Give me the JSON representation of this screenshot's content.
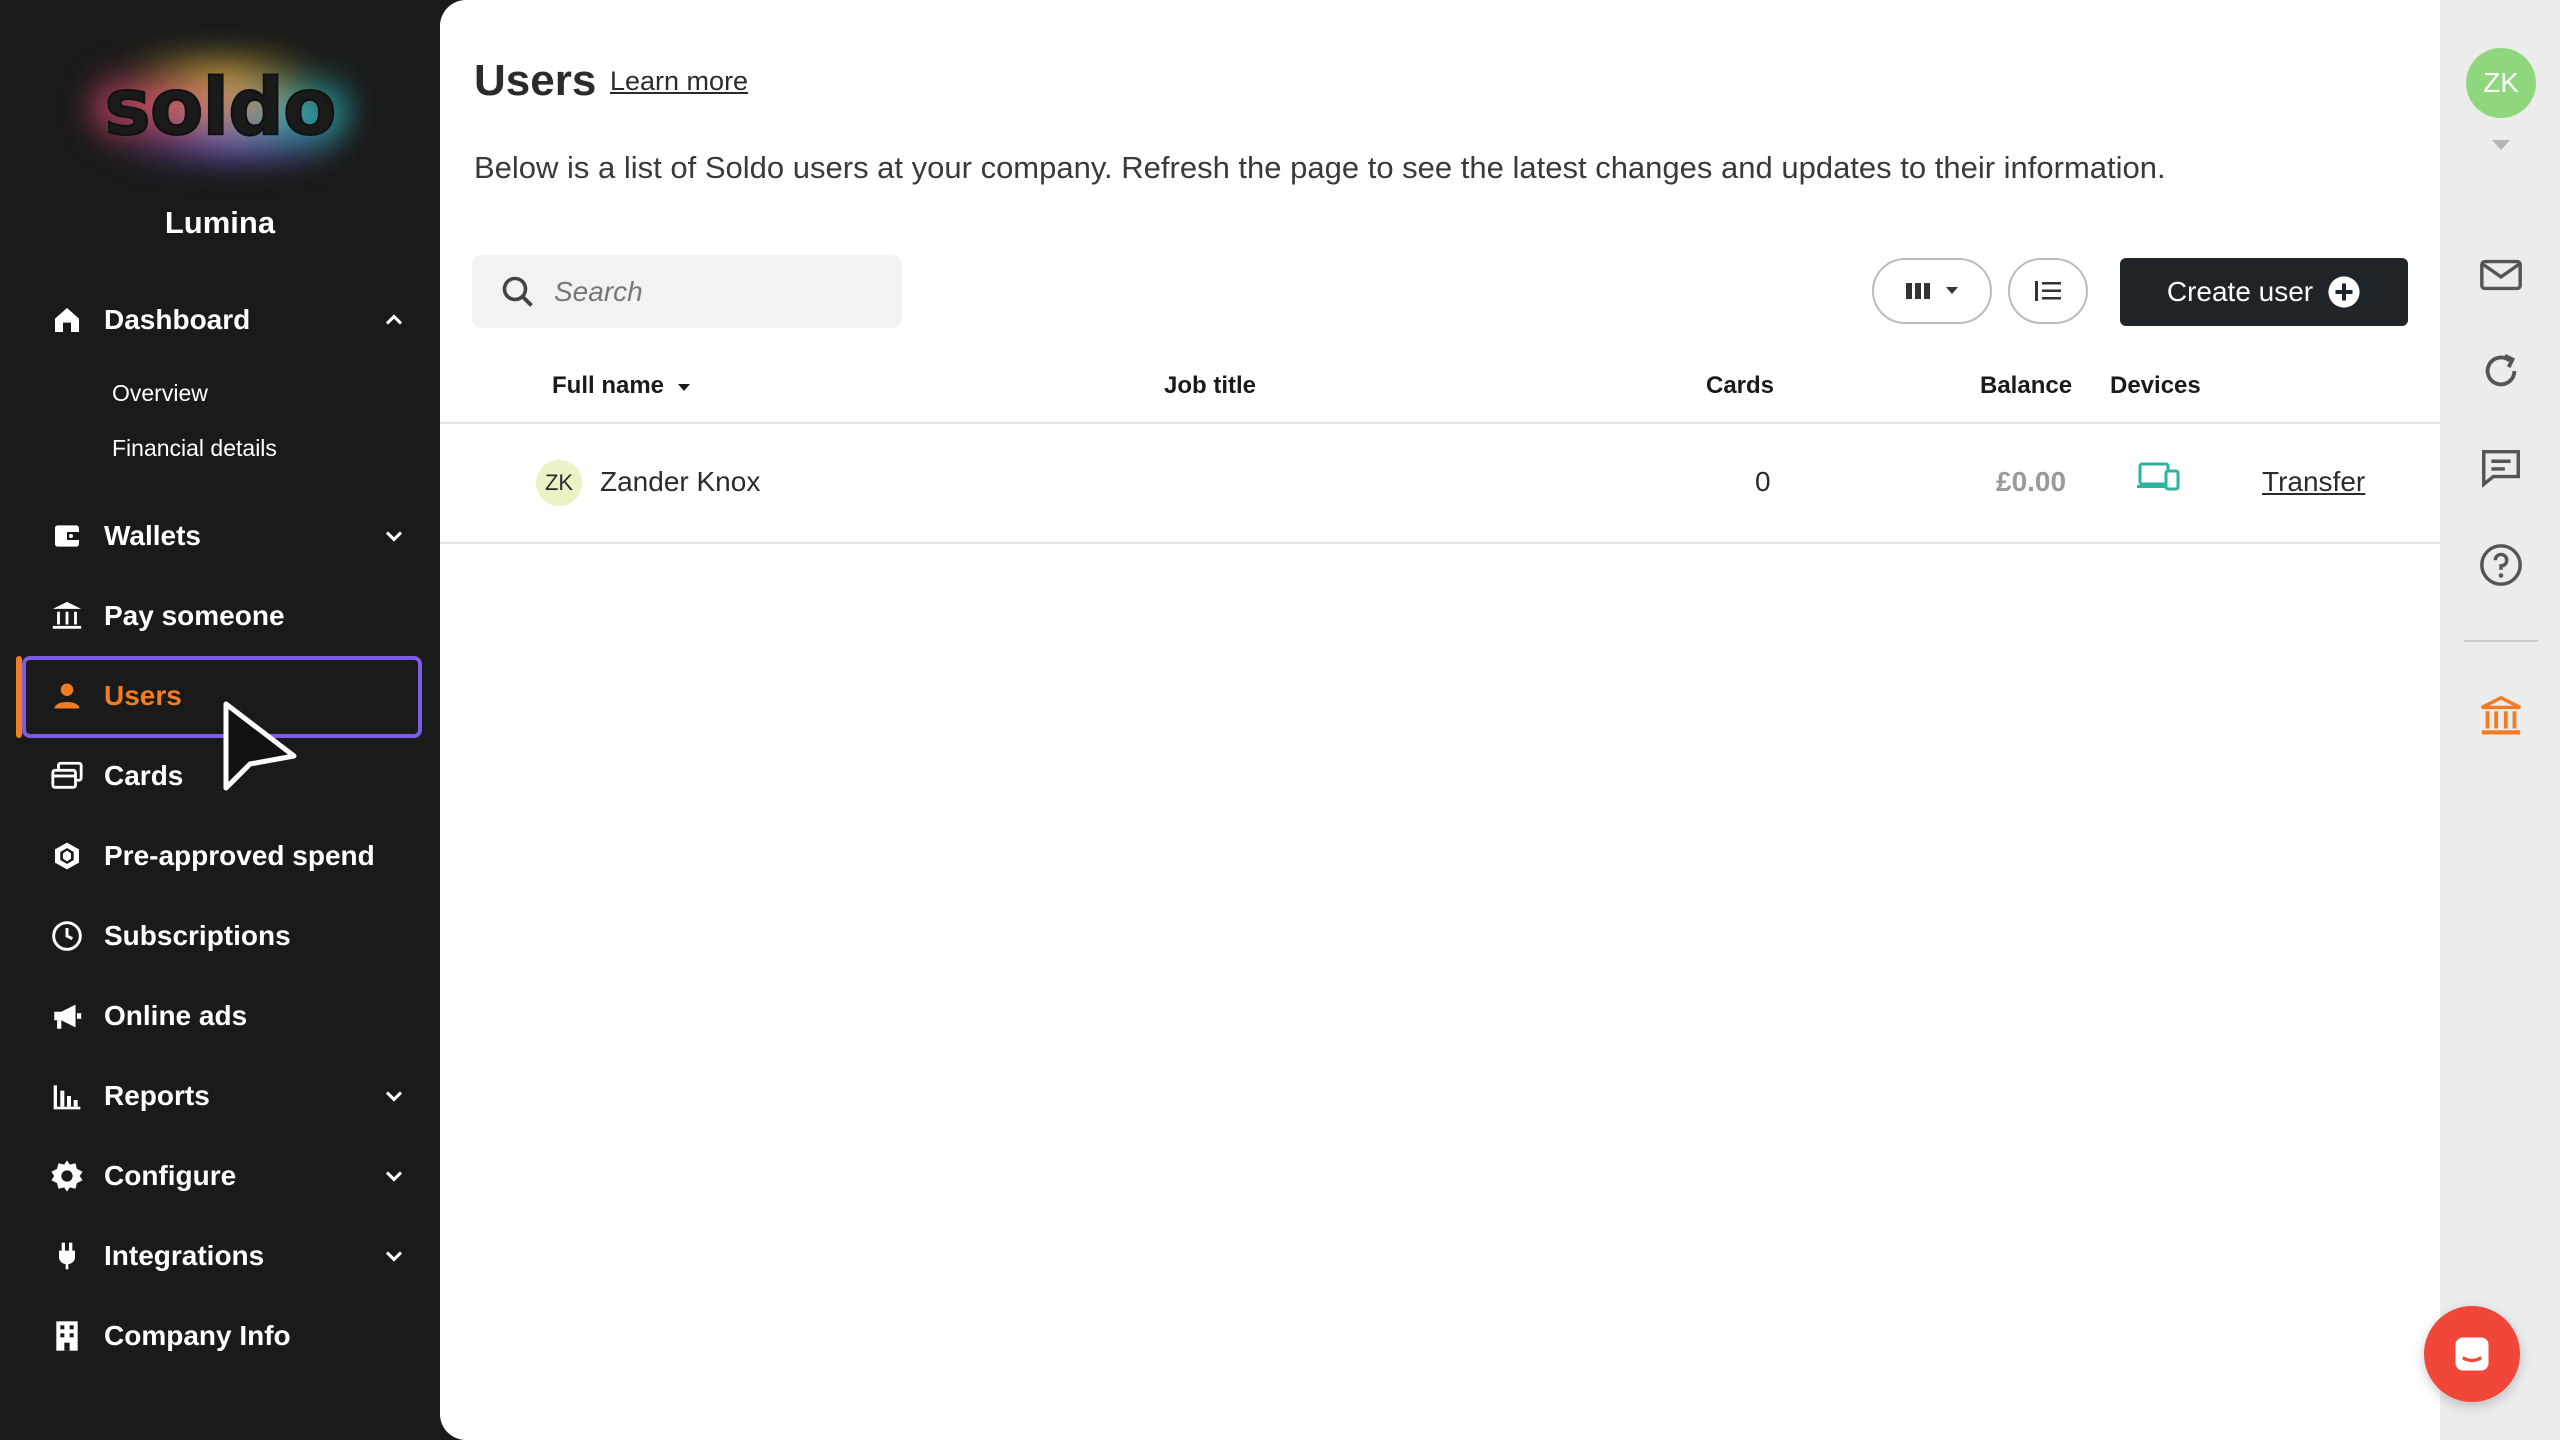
{
  "app": {
    "logo_text": "soldo",
    "company_name": "Lumina"
  },
  "sidebar": {
    "items": [
      {
        "label": "Dashboard",
        "icon": "home-icon",
        "expanded": true
      },
      {
        "label": "Wallets",
        "icon": "wallet-icon"
      },
      {
        "label": "Pay someone",
        "icon": "bank-transfer-icon"
      },
      {
        "label": "Users",
        "icon": "user-icon",
        "active": true
      },
      {
        "label": "Cards",
        "icon": "cards-icon"
      },
      {
        "label": "Pre-approved spend",
        "icon": "hexagon-icon"
      },
      {
        "label": "Subscriptions",
        "icon": "clock-icon"
      },
      {
        "label": "Online ads",
        "icon": "megaphone-icon"
      },
      {
        "label": "Reports",
        "icon": "bar-chart-icon"
      },
      {
        "label": "Configure",
        "icon": "gear-icon"
      },
      {
        "label": "Integrations",
        "icon": "plug-icon"
      },
      {
        "label": "Company Info",
        "icon": "building-icon"
      }
    ],
    "dashboard_sub": [
      "Overview",
      "Financial details"
    ],
    "active_color": "#f27c22",
    "focus_color": "#7b5ce6"
  },
  "main": {
    "title": "Users",
    "learn_more": "Learn more",
    "description": "Below is a list of Soldo users at your company. Refresh the page to see the latest changes and updates to their information.",
    "search_placeholder": "Search",
    "create_button": "Create user",
    "table": {
      "headers": [
        "Full name",
        "Job title",
        "Cards",
        "Balance",
        "Devices"
      ],
      "rows": [
        {
          "initials": "ZK",
          "name": "Zander Knox",
          "job_title": "",
          "cards": "0",
          "balance": "£0.00",
          "action": "Transfer"
        }
      ]
    }
  },
  "rail": {
    "avatar_initials": "ZK",
    "avatar_color": "#8fd77c"
  }
}
